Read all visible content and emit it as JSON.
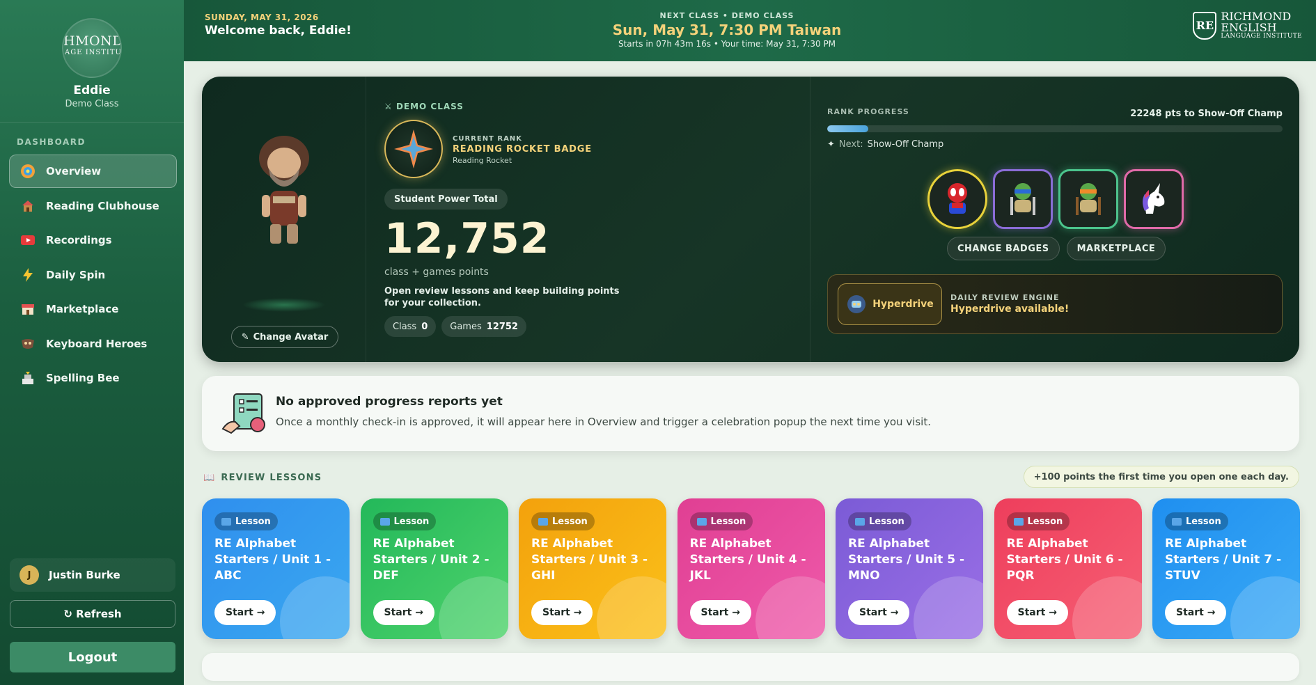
{
  "sidebar": {
    "logo_line1": "HMOND",
    "logo_line2": "AGE INSTITU",
    "name": "Eddie",
    "class": "Demo Class",
    "section_label": "DASHBOARD",
    "items": [
      {
        "label": "Overview",
        "icon": "globe-icon",
        "active": true
      },
      {
        "label": "Reading Clubhouse",
        "icon": "clubhouse-icon"
      },
      {
        "label": "Recordings",
        "icon": "video-icon"
      },
      {
        "label": "Daily Spin",
        "icon": "lightning-icon"
      },
      {
        "label": "Marketplace",
        "icon": "store-icon"
      },
      {
        "label": "Keyboard Heroes",
        "icon": "mask-icon"
      },
      {
        "label": "Spelling Bee",
        "icon": "trophy-icon"
      }
    ],
    "user_initial": "J",
    "user_name": "Justin Burke",
    "refresh_label": "↻ Refresh",
    "logout_label": "Logout"
  },
  "topbar": {
    "date": "SUNDAY, MAY 31, 2026",
    "welcome": "Welcome back, Eddie!",
    "next_label": "NEXT CLASS • DEMO CLASS",
    "next_time": "Sun, May 31, 7:30 PM Taiwan",
    "starts": "Starts in 07h 43m 16s • Your time: May 31, 7:30 PM",
    "logo_line1": "RICHMOND",
    "logo_line2": "ENGLISH",
    "logo_line3": "LANGUAGE INSTITUTE",
    "logo_shield": "RE"
  },
  "hero": {
    "change_avatar": "Change Avatar",
    "demo_tag": "DEMO CLASS",
    "rank_label": "CURRENT RANK",
    "rank_name": "READING ROCKET BADGE",
    "rank_sub": "Reading Rocket",
    "power_label": "Student Power Total",
    "power_total": "12,752",
    "power_sub": "class + games points",
    "power_desc": "Open review lessons and keep building points for your collection.",
    "class_label": "Class",
    "class_value": "0",
    "games_label": "Games",
    "games_value": "12752",
    "rank_progress_label": "RANK PROGRESS",
    "rank_progress_pts": "22248 pts to Show-Off Champ",
    "rank_progress_fraction": 0.09,
    "next_label": "Next:",
    "next_rank": "Show-Off Champ",
    "badges": [
      "spider-hero-icon",
      "turtle-blue-icon",
      "turtle-orange-icon",
      "unicorn-icon"
    ],
    "change_badges": "CHANGE BADGES",
    "marketplace": "MARKETPLACE",
    "hyperdrive_btn": "Hyperdrive",
    "hyperdrive_label": "DAILY REVIEW ENGINE",
    "hyperdrive_status": "Hyperdrive available!"
  },
  "report": {
    "title": "No approved progress reports yet",
    "text": "Once a monthly check-in is approved, it will appear here in Overview and trigger a celebration popup the next time you visit."
  },
  "review": {
    "heading": "REVIEW LESSONS",
    "note": "+100 points the first time you open one each day.",
    "tag_label": "Lesson",
    "start_label": "Start →",
    "lessons": [
      {
        "title": "RE Alphabet Starters / Unit 1 - ABC",
        "color_a": "#2f8fee",
        "color_b": "#3aa8f0"
      },
      {
        "title": "RE Alphabet Starters / Unit 2 - DEF",
        "color_a": "#23b85a",
        "color_b": "#4fd36c"
      },
      {
        "title": "RE Alphabet Starters / Unit 3 - GHI",
        "color_a": "#f3a10c",
        "color_b": "#fbc11a"
      },
      {
        "title": "RE Alphabet Starters / Unit 4 - JKL",
        "color_a": "#e03f93",
        "color_b": "#ef5aaa"
      },
      {
        "title": "RE Alphabet Starters / Unit 5 - MNO",
        "color_a": "#7b5bd6",
        "color_b": "#9a6fe6"
      },
      {
        "title": "RE Alphabet Starters / Unit 6 - PQR",
        "color_a": "#ee3e5c",
        "color_b": "#f65f74"
      },
      {
        "title": "RE Alphabet Starters / Unit 7 - STUV",
        "color_a": "#1f8ff0",
        "color_b": "#39a9f5"
      }
    ]
  }
}
